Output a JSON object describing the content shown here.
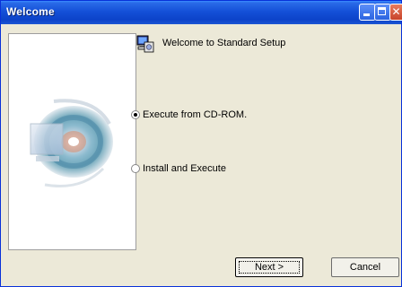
{
  "window": {
    "title": "Welcome"
  },
  "heading": "Welcome to Standard Setup",
  "options": [
    {
      "label": "Execute from CD-ROM.",
      "selected": true
    },
    {
      "label": "Install and Execute",
      "selected": false
    }
  ],
  "buttons": {
    "next": "Next >",
    "cancel": "Cancel"
  },
  "icons": {
    "setup": "computer-setup-icon",
    "banner": "cd-disc-illustration"
  },
  "colors": {
    "titlebar": "#0c43c9",
    "face": "#ece9d8"
  }
}
